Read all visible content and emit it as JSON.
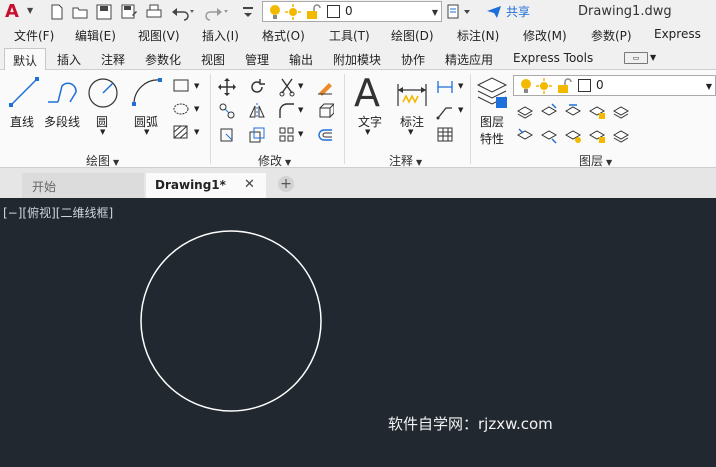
{
  "qat": {
    "layer_value": "0",
    "share_label": "共享",
    "doc_title": "Drawing1.dwg"
  },
  "menubar": {
    "items": [
      "文件(F)",
      "编辑(E)",
      "视图(V)",
      "插入(I)",
      "格式(O)",
      "工具(T)",
      "绘图(D)",
      "标注(N)",
      "修改(M)",
      "参数(P)",
      "Express"
    ]
  },
  "ribbon_tabs": {
    "items": [
      "默认",
      "插入",
      "注释",
      "参数化",
      "视图",
      "管理",
      "输出",
      "附加模块",
      "协作",
      "精选应用",
      "Express Tools"
    ],
    "active": "默认"
  },
  "ribbon": {
    "draw": {
      "title": "绘图",
      "line": "直线",
      "polyline": "多段线",
      "circle": "圆",
      "arc": "圆弧"
    },
    "modify": {
      "title": "修改"
    },
    "annotation": {
      "title": "注释",
      "text": "文字",
      "dimension": "标注"
    },
    "layers": {
      "title": "图层",
      "props_line1": "图层",
      "props_line2": "特性",
      "layer_value": "0"
    }
  },
  "doc_tabs": {
    "start": "开始",
    "active": "Drawing1*",
    "close": "✕",
    "add": "+"
  },
  "canvas": {
    "view_label": "[−][俯视][二维线框]",
    "watermark": "软件自学网：rjzxw.com"
  },
  "colors": {
    "canvas_bg": "#212830",
    "accent": "#1e6fd9",
    "brand": "#c8102e",
    "circle": "#ffffff"
  }
}
